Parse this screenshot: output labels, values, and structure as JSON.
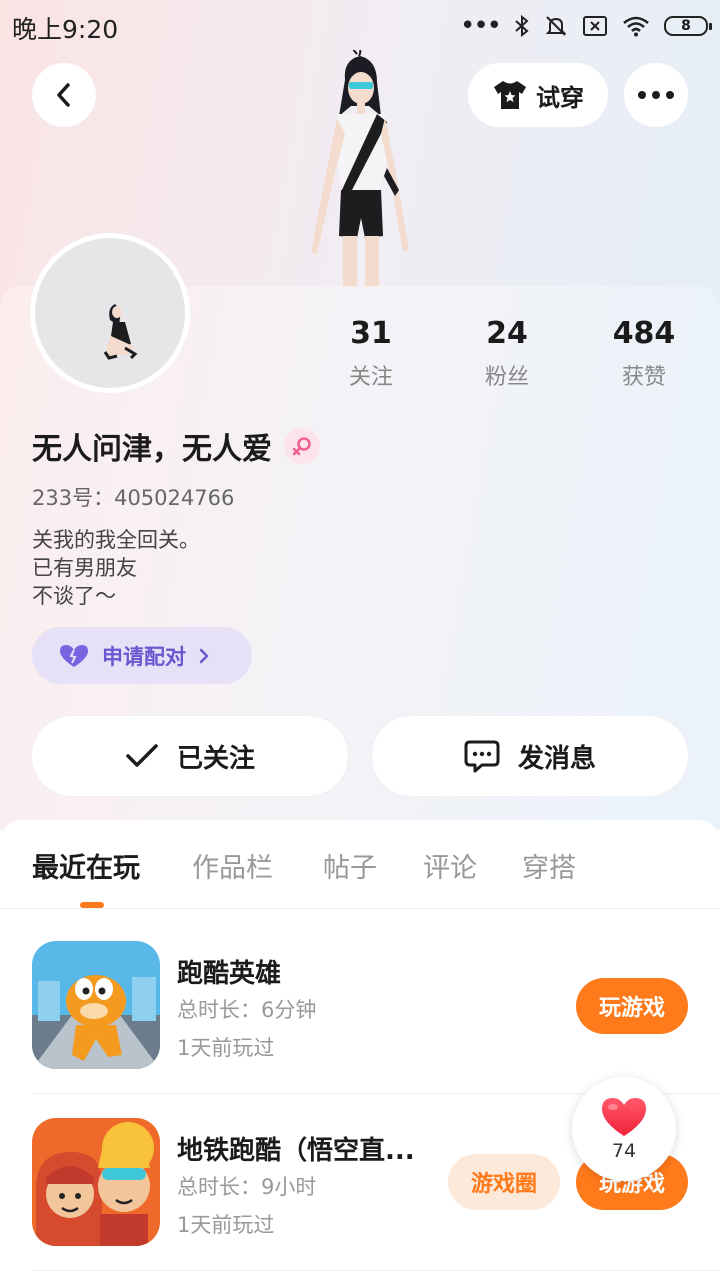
{
  "status_bar": {
    "time": "晚上9:20",
    "battery": "8"
  },
  "header": {
    "try_on_label": "试穿"
  },
  "profile": {
    "nickname": "无人问津，无人爱",
    "user_id": "233号：405024766",
    "bio_lines": [
      "关我的我全回关。",
      "已有男朋友",
      "不谈了～"
    ],
    "stats": [
      {
        "value": "31",
        "label": "关注"
      },
      {
        "value": "24",
        "label": "粉丝"
      },
      {
        "value": "484",
        "label": "获赞"
      }
    ],
    "pair_label": "申请配对"
  },
  "actions": {
    "followed_label": "已关注",
    "message_label": "发消息"
  },
  "tabs": [
    "最近在玩",
    "作品栏",
    "帖子",
    "评论",
    "穿搭"
  ],
  "games": [
    {
      "title": "跑酷英雄",
      "duration": "总时长：6分钟",
      "last_played": "1天前玩过",
      "play_label": "玩游戏"
    },
    {
      "title": "地铁跑酷（悟空直...",
      "duration": "总时长：9小时",
      "last_played": "1天前玩过",
      "circle_label": "游戏圈",
      "play_label": "玩游戏"
    }
  ],
  "like_float": {
    "count": "74"
  },
  "colors": {
    "accent": "#ff7a1a",
    "pair_purple": "#6a56d0"
  }
}
